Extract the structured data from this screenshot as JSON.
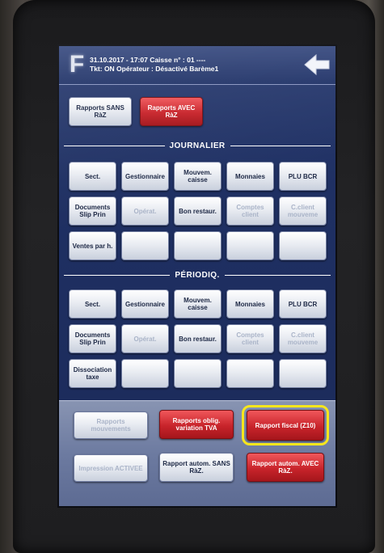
{
  "header": {
    "logo": "F",
    "line1": "31.10.2017 - 17:07   Caisse n° : 01 ----",
    "line2": "Tkt: ON Opérateur : Désactivé   Barème1"
  },
  "top_buttons": {
    "sans_raz": "Rapports SANS RàZ",
    "avec_raz": "Rapports AVEC RàZ"
  },
  "journalier": {
    "title": "JOURNALIER",
    "row1": [
      "Sect.",
      "Gestionnaire",
      "Mouvem. caisse",
      "Monnaies",
      "PLU BCR"
    ],
    "row2": [
      "Documents Slip Prin",
      "Opérat.",
      "Bon restaur.",
      "Comptes client",
      "C.client mouveme"
    ],
    "row3": [
      "Ventes par h.",
      "",
      "",
      "",
      ""
    ]
  },
  "periodiq": {
    "title": "PÉRIODIQ.",
    "row1": [
      "Sect.",
      "Gestionnaire",
      "Mouvem. caisse",
      "Monnaies",
      "PLU BCR"
    ],
    "row2": [
      "Documents Slip Prin",
      "Opérat.",
      "Bon restaur.",
      "Comptes client",
      "C.client mouveme"
    ],
    "row3": [
      "Dissociation taxe",
      "",
      "",
      "",
      ""
    ]
  },
  "bottom": {
    "rapports_mouvements": "Rapports mouvements",
    "rapports_oblig": "Rapports oblig. variation TVA",
    "rapport_fiscal": "Rapport fiscal (Z10)",
    "impression": "Impression ACTIVEE",
    "autom_sans": "Rapport autom. SANS RàZ.",
    "autom_avec": "Rapport autom. AVEC RàZ."
  },
  "colors": {
    "screen_bg": "#1f3063",
    "red_button": "#c8242b",
    "highlight": "#f7e61c"
  }
}
